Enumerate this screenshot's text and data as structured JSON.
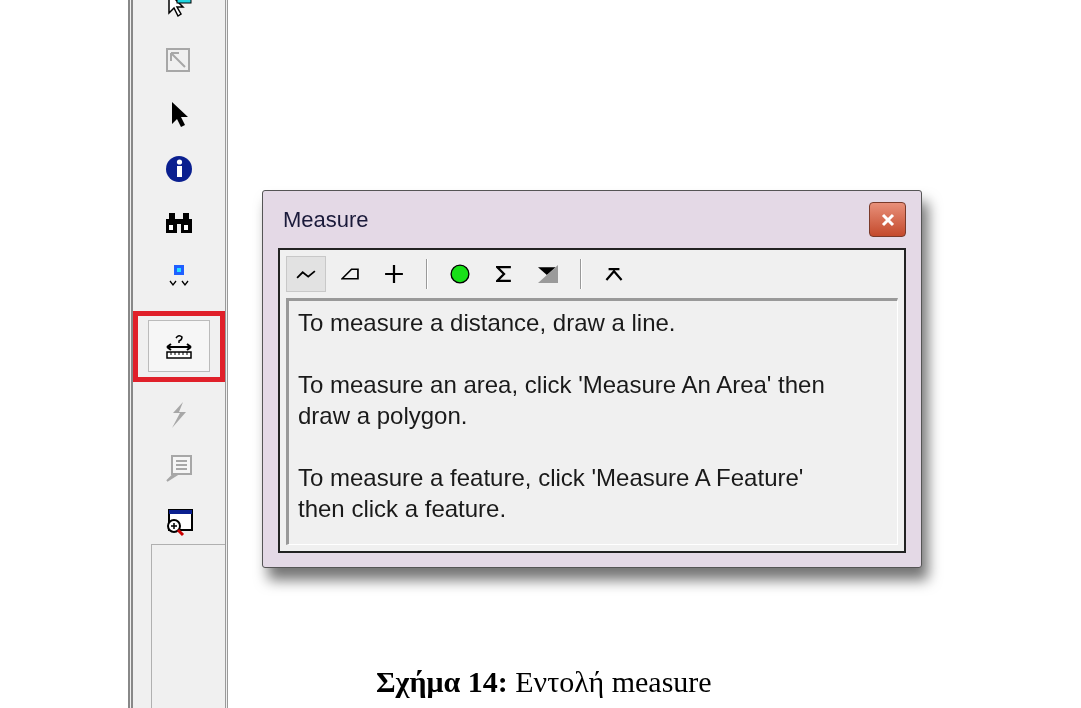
{
  "tools_toolbar": {
    "tools": [
      {
        "kind": "select",
        "disabled": false,
        "highlighted": false
      },
      {
        "kind": "clear",
        "disabled": true,
        "highlighted": false
      },
      {
        "kind": "pointer",
        "disabled": false,
        "highlighted": false
      },
      {
        "kind": "identify",
        "disabled": false,
        "highlighted": false
      },
      {
        "kind": "find",
        "disabled": false,
        "highlighted": false
      },
      {
        "kind": "goto",
        "disabled": false,
        "highlighted": false
      },
      {
        "kind": "measure",
        "disabled": false,
        "highlighted": true
      },
      {
        "kind": "hyperlink",
        "disabled": true,
        "highlighted": false
      },
      {
        "kind": "popup",
        "disabled": true,
        "highlighted": false
      },
      {
        "kind": "viewer",
        "disabled": false,
        "highlighted": false
      }
    ]
  },
  "dialog": {
    "title": "Measure",
    "toolbar": [
      {
        "kind": "line",
        "selected": true
      },
      {
        "kind": "area",
        "selected": false
      },
      {
        "kind": "feature",
        "selected": false
      },
      {
        "kind": "separator"
      },
      {
        "kind": "snap",
        "selected": false
      },
      {
        "kind": "total",
        "selected": false
      },
      {
        "kind": "units",
        "selected": false
      },
      {
        "kind": "separator"
      },
      {
        "kind": "clear",
        "selected": false
      }
    ],
    "message": [
      "To measure a distance, draw a line.",
      "To measure an area, click 'Measure An Area' then draw a polygon.",
      "To measure a feature, click 'Measure A Feature' then click a feature."
    ]
  },
  "caption": "**Σχήμα 14:** Εντολή measure"
}
